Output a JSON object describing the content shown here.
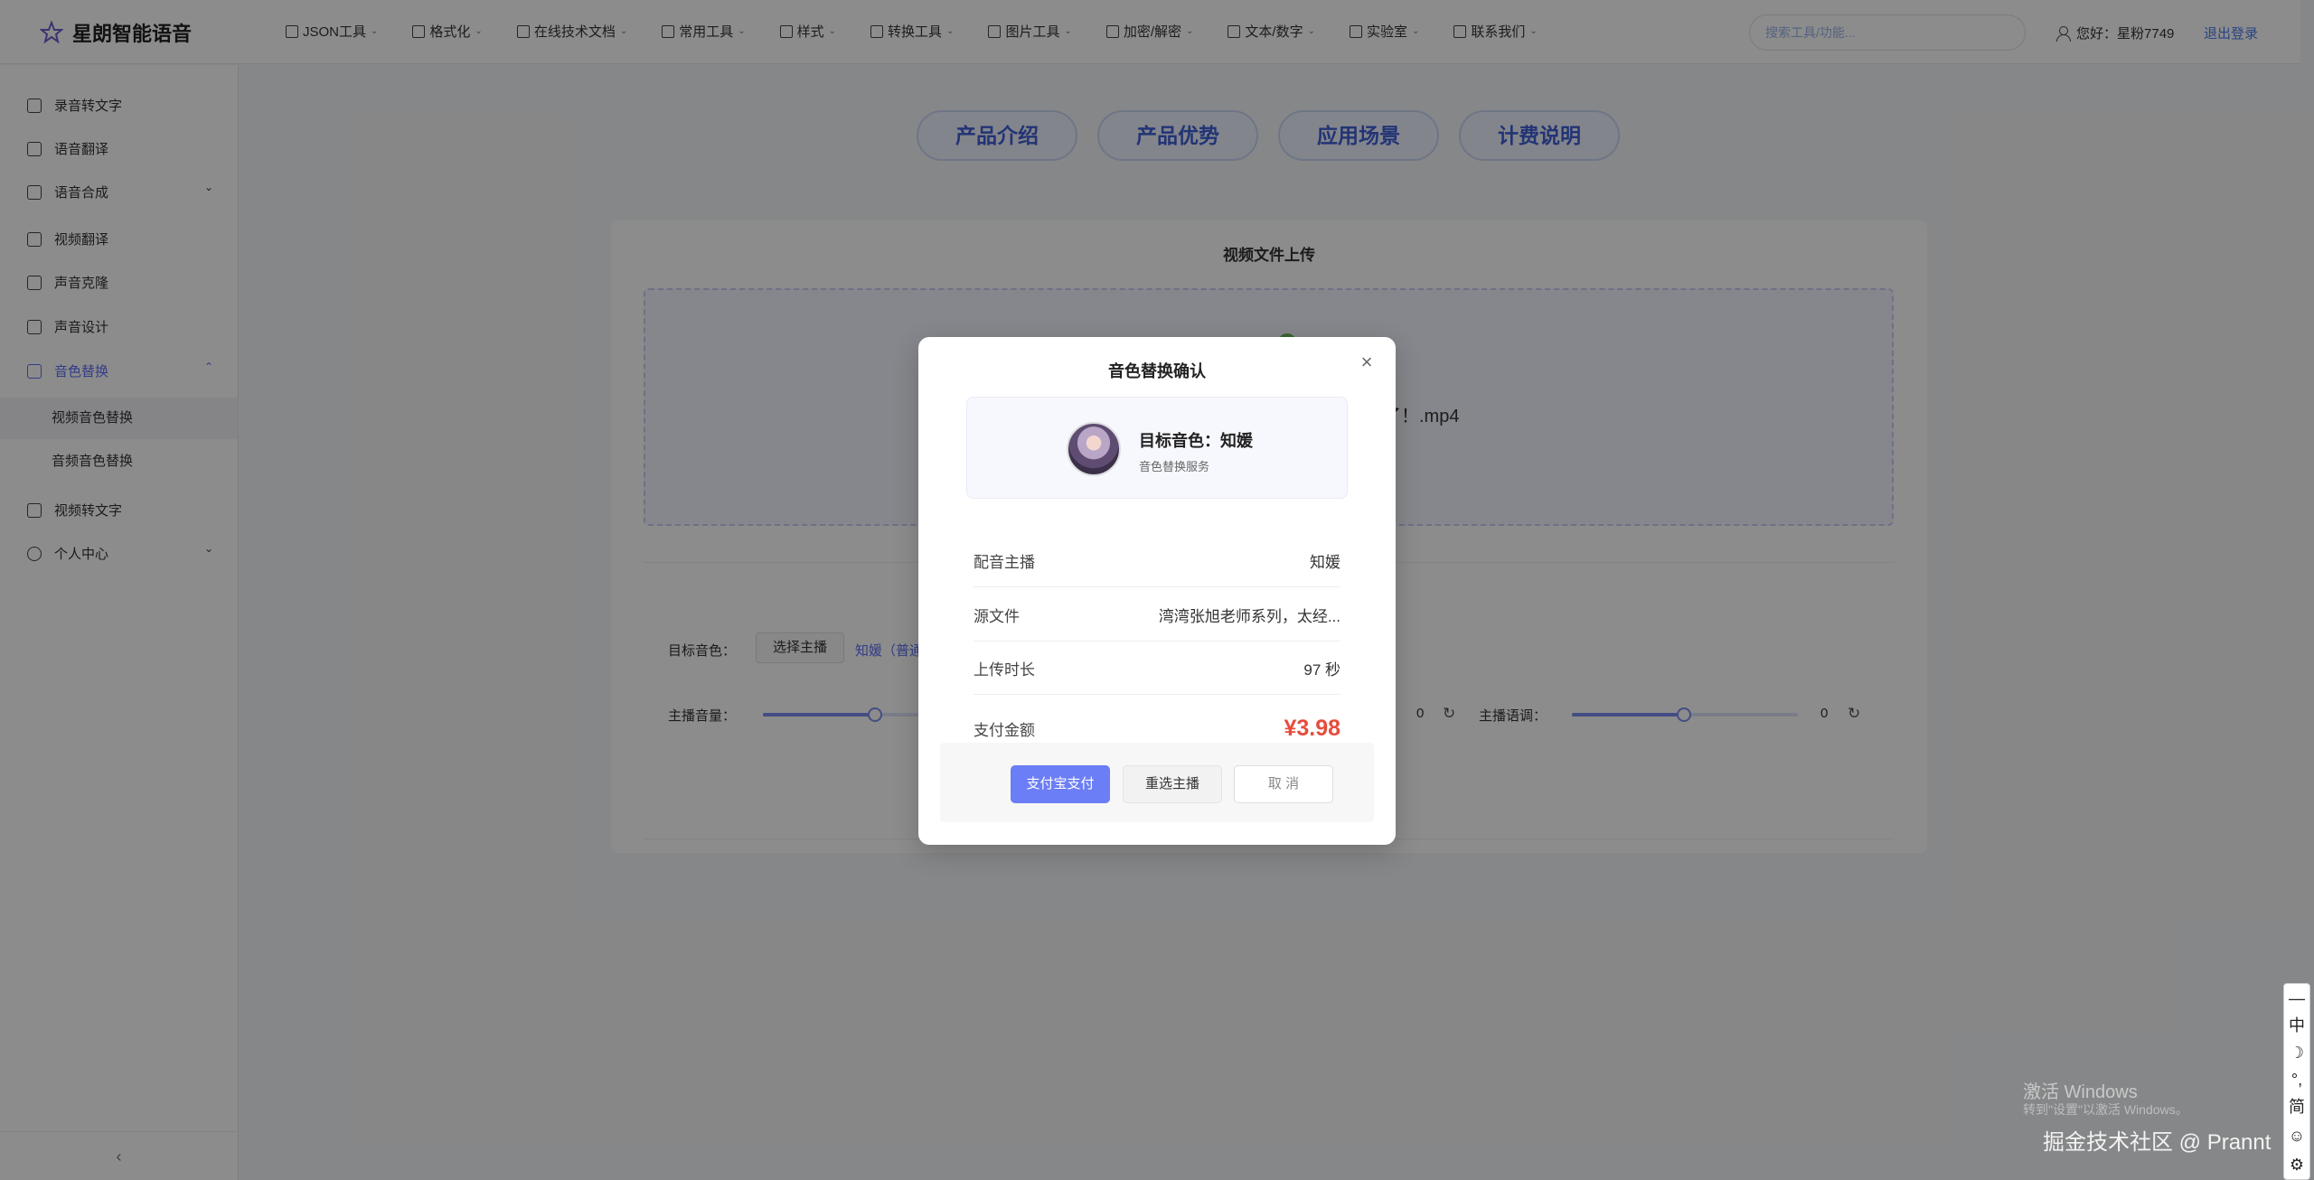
{
  "app": {
    "title": "星朗智能语音"
  },
  "nav": [
    {
      "label": "JSON工具"
    },
    {
      "label": "格式化"
    },
    {
      "label": "在线技术文档"
    },
    {
      "label": "常用工具"
    },
    {
      "label": "样式"
    },
    {
      "label": "转换工具"
    },
    {
      "label": "图片工具"
    },
    {
      "label": "加密/解密"
    },
    {
      "label": "文本/数字"
    },
    {
      "label": "实验室"
    },
    {
      "label": "联系我们"
    }
  ],
  "search": {
    "placeholder": "搜索工具/功能..."
  },
  "user": {
    "greeting": "您好：",
    "name": "星粉7749",
    "logout": "退出登录"
  },
  "sidebar": {
    "items": [
      {
        "label": "录音转文字",
        "icon": "microphone-icon"
      },
      {
        "label": "语音翻译",
        "icon": "translate-icon"
      },
      {
        "label": "语音合成",
        "icon": "mic-icon",
        "caret": "⌄"
      },
      {
        "label": "视频翻译",
        "icon": "video-icon"
      },
      {
        "label": "声音克隆",
        "icon": "clone-icon"
      },
      {
        "label": "声音设计",
        "icon": "design-icon"
      },
      {
        "label": "音色替换",
        "icon": "swap-icon",
        "caret": "⌃"
      },
      {
        "label": "视频转文字",
        "icon": "video-text-icon"
      },
      {
        "label": "个人中心",
        "icon": "user-icon",
        "caret": "⌄"
      }
    ],
    "sub_items": [
      {
        "label": "视频音色替换"
      },
      {
        "label": "音频音色替换"
      }
    ],
    "collapse": "‹"
  },
  "tabs": [
    {
      "label": "产品介绍"
    },
    {
      "label": "产品优势"
    },
    {
      "label": "应用场景"
    },
    {
      "label": "计费说明"
    }
  ],
  "upload": {
    "title": "视频文件上传",
    "file_suffix": "了！.mp4"
  },
  "settings": {
    "target_voice_label": "目标音色：",
    "choose_button": "选择主播",
    "current_voice": "知媛（普通",
    "volume_label": "主播音量：",
    "speed_value": "0",
    "pitch_label": "主播语调：",
    "pitch_value": "0"
  },
  "modal": {
    "title": "音色替换确认",
    "voice_name": "目标音色：知媛",
    "voice_sub": "音色替换服务",
    "rows": [
      {
        "key": "配音主播",
        "value": "知媛"
      },
      {
        "key": "源文件",
        "value": "湾湾张旭老师系列，太经..."
      },
      {
        "key": "上传时长",
        "value": "97 秒"
      },
      {
        "key": "支付金额",
        "value": "¥3.98"
      }
    ],
    "pay_button": "支付宝支付",
    "reselect_button": "重选主播",
    "cancel_button": "取 消"
  },
  "ime": {
    "items": [
      "—",
      "中",
      "☽",
      "°,",
      "简",
      "☺",
      "⚙"
    ]
  },
  "watermarks": {
    "windows": "激活 Windows",
    "windows_sub": "转到\"设置\"以激活 Windows。",
    "juejin": "掘金技术社区 @ Prannt"
  },
  "colors": {
    "accent": "#5b6ef5",
    "price": "#e74c3c"
  }
}
